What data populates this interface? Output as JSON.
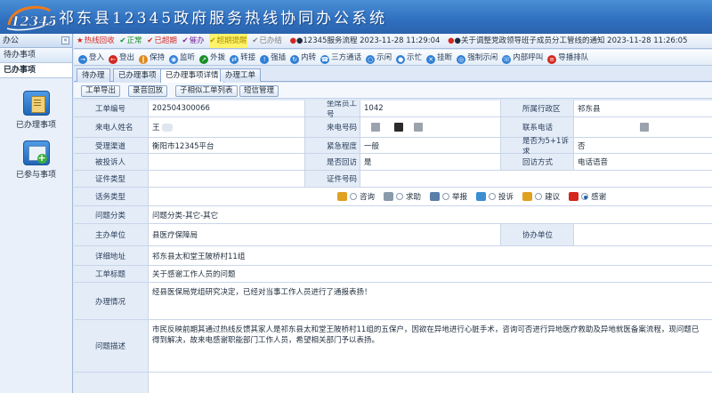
{
  "app": {
    "title": "祁东县12345政府服务热线协同办公系统",
    "logo_text": "12345"
  },
  "sidebar": {
    "header": "办公",
    "sections": [
      "待办事项",
      "已办事项"
    ],
    "icon_items": [
      {
        "label": "已办理事项",
        "icon": "documents-icon"
      },
      {
        "label": "已参与事项",
        "icon": "add-task-icon"
      }
    ]
  },
  "statusbar": {
    "items": [
      {
        "icon": "★",
        "text": "热线回收",
        "color": "#d4271f"
      },
      {
        "icon": "✔",
        "text": "正常",
        "color": "#1b8f2a"
      },
      {
        "icon": "✔",
        "text": "已超期",
        "color": "#d4271f"
      },
      {
        "icon": "✔",
        "text": "催办",
        "color": "#7a2aa0"
      },
      {
        "icon": "✔",
        "text": "超期提醒",
        "color": "#b09400"
      },
      {
        "icon": "✔",
        "text": "已办结",
        "color": "#7f7f7f"
      }
    ],
    "notice_1": "●12345服务流程  2023-11-28 11:29:04",
    "notice_2": "●关于调整党政领导班子成员分工管线的通知  2023-11-28 11:26:05"
  },
  "toolbar": {
    "buttons": [
      {
        "label": "登入",
        "color": "#2f7fd6",
        "icon": "login-icon"
      },
      {
        "label": "登出",
        "color": "#d4271f",
        "icon": "logout-icon"
      },
      {
        "label": "保持",
        "color": "#e08a1a",
        "icon": "hold-icon"
      },
      {
        "label": "监听",
        "color": "#2f7fd6",
        "icon": "monitor-icon"
      },
      {
        "label": "外拨",
        "color": "#1b8f2a",
        "icon": "dial-out-icon"
      },
      {
        "label": "转接",
        "color": "#2f7fd6",
        "icon": "transfer-icon"
      },
      {
        "label": "强插",
        "color": "#2f7fd6",
        "icon": "barge-in-icon"
      },
      {
        "label": "内转",
        "color": "#2f7fd6",
        "icon": "internal-transfer-icon"
      },
      {
        "label": "三方通话",
        "color": "#2f7fd6",
        "icon": "conference-icon"
      },
      {
        "label": "示闲",
        "color": "#2f7fd6",
        "icon": "idle-icon"
      },
      {
        "label": "示忙",
        "color": "#2f7fd6",
        "icon": "busy-icon"
      },
      {
        "label": "挂断",
        "color": "#2f7fd6",
        "icon": "hangup-icon"
      },
      {
        "label": "强制示闲",
        "color": "#2f7fd6",
        "icon": "force-idle-icon"
      },
      {
        "label": "内部呼叫",
        "color": "#2f7fd6",
        "icon": "internal-call-icon"
      },
      {
        "label": "导播排队",
        "color": "#d4271f",
        "icon": "queue-icon"
      }
    ]
  },
  "tabs": [
    "待办理",
    "已办理事项",
    "已办理事项详情",
    "办理工单"
  ],
  "actions": [
    "工单导出",
    "录音回放",
    "子相似工单列表",
    "短信管理"
  ],
  "form": {
    "order_no_label": "工单编号",
    "order_no": "202504300066",
    "agent_label": "坐席员工号",
    "agent": "1042",
    "district_label": "所属行政区",
    "district": "祁东县",
    "caller_label": "来电人姓名",
    "caller": "王",
    "caller_phone_label": "来电号码",
    "contact_label": "联系电话",
    "channel_label": "受理渠道",
    "channel": "衡阳市12345平台",
    "urgency_label": "紧急程度",
    "urgency": "一般",
    "five_one_label": "是否为5+1诉求",
    "five_one": "否",
    "complainee_label": "被投诉人",
    "complainee": "",
    "revisit_label": "是否回访",
    "revisit": "是",
    "revisit_mode_label": "回访方式",
    "revisit_mode": "电话语音",
    "id_type_label": "证件类型",
    "id_type": "",
    "id_no_label": "证件号码",
    "id_no": "",
    "topic_type_label": "话务类型",
    "topic_options": [
      {
        "text": "咨询",
        "color": "#e0a020"
      },
      {
        "text": "求助",
        "color": "#8a9aab"
      },
      {
        "text": "举报",
        "color": "#5a7fa8"
      },
      {
        "text": "投诉",
        "color": "#3b8fd0"
      },
      {
        "text": "建议",
        "color": "#e0a020"
      },
      {
        "text": "感谢",
        "color": "#d4271f"
      }
    ],
    "topic_selected": "感谢",
    "category_label": "问题分类",
    "category": "问题分类-其它-其它",
    "main_unit_label": "主办单位",
    "main_unit": "县医疗保障局",
    "co_unit_label": "协办单位",
    "co_unit": "",
    "address_label": "详细地址",
    "address": "祁东县太和堂王陂桥村11组",
    "subject_label": "工单标题",
    "subject": "关于感谢工作人员的问题",
    "handling_label": "办理情况",
    "handling": "经县医保局党组研究决定，已经对当事工作人员进行了通报表扬！",
    "description_label": "问题描述",
    "description": "市民反映前期其通过热线反馈其家人是祁东县太和堂王陂桥村11组的五保户，因欲在异地进行心脏手术，咨询可否进行异地医疗救助及异地就医备案流程，现问题已得到解决，故来电感谢职能部门工作人员，希望相关部门予以表扬。"
  }
}
